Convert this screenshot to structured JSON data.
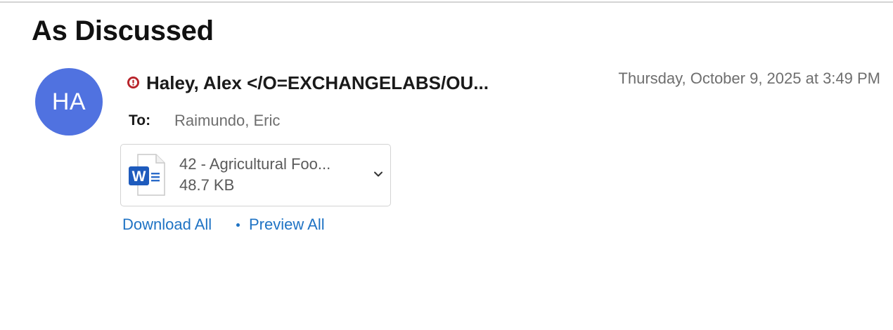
{
  "message": {
    "subject": "As Discussed",
    "sender": {
      "initials": "HA",
      "display": "Haley, Alex </O=EXCHANGELABS/OU...",
      "avatar_color": "#5072e0"
    },
    "priority": {
      "icon": "high-priority-icon",
      "color": "#b8232a"
    },
    "timestamp": "Thursday, October 9, 2025 at 3:49 PM",
    "recipients": {
      "label": "To:",
      "value": "Raimundo, Eric"
    }
  },
  "attachments": [
    {
      "icon": "word-document-icon",
      "name": "42 - Agricultural Foo...",
      "size": "48.7 KB"
    }
  ],
  "actions": {
    "download_all": "Download All",
    "preview_all": "Preview All",
    "link_color": "#1f73c4"
  }
}
